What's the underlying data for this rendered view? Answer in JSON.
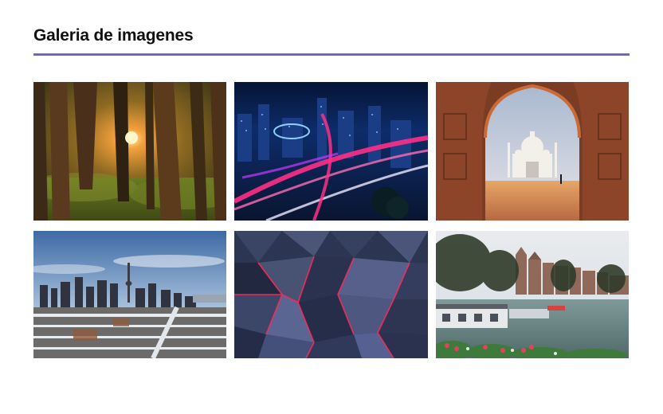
{
  "header": {
    "title": "Galeria de imagenes",
    "accent_color": "#7466b8"
  },
  "gallery": {
    "images": [
      {
        "subject": "forest",
        "accent_color": "#f3a03c"
      },
      {
        "subject": "city-night",
        "accent_color": "#ff2f87"
      },
      {
        "subject": "taj-mahal",
        "accent_color": "#9c4b2e"
      },
      {
        "subject": "city-skyline",
        "accent_color": "#3d6aa4"
      },
      {
        "subject": "geometric",
        "accent_color": "#ff2a5b"
      },
      {
        "subject": "canal",
        "accent_color": "#5a7f7a"
      }
    ]
  }
}
